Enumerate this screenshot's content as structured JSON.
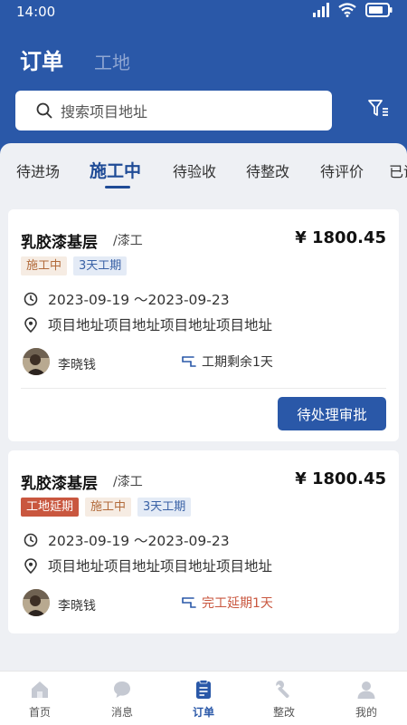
{
  "status_bar": {
    "time": "14:00",
    "icons": [
      "signal-icon",
      "wifi-icon",
      "battery-icon"
    ]
  },
  "header": {
    "tabs": [
      {
        "label": "订单",
        "active": true
      },
      {
        "label": "工地",
        "active": false
      }
    ]
  },
  "search": {
    "placeholder": "搜索项目地址"
  },
  "status_tabs": [
    "待进场",
    "施工中",
    "待验收",
    "待整改",
    "待评价",
    "已评"
  ],
  "active_status_tab": "施工中",
  "orders": [
    {
      "title": "乳胶漆基层",
      "type": "/漆工",
      "price": "¥ 1800.45",
      "tags": [
        {
          "label": "施工中",
          "style": "orange"
        },
        {
          "label": "3天工期",
          "style": "blue"
        }
      ],
      "date_range": "2023-09-19 ～2023-09-23",
      "address": "项目地址项目地址项目地址项目地址",
      "person": "李晓钱",
      "duration": "工期剩余1天",
      "action": "待处理审批"
    },
    {
      "title": "乳胶漆基层",
      "type": "/漆工",
      "price": "¥ 1800.45",
      "tags": [
        {
          "label": "工地延期",
          "style": "red"
        },
        {
          "label": "施工中",
          "style": "orange"
        },
        {
          "label": "3天工期",
          "style": "blue"
        }
      ],
      "date_range": "2023-09-19 ～2023-09-23",
      "address": "项目地址项目地址项目地址项目地址",
      "person": "李晓钱",
      "duration": "完工延期1天"
    }
  ],
  "bottom_nav": [
    {
      "label": "首页",
      "icon": "home-icon"
    },
    {
      "label": "消息",
      "icon": "message-icon"
    },
    {
      "label": "订单",
      "icon": "order-icon",
      "active": true
    },
    {
      "label": "整改",
      "icon": "wrench-icon"
    },
    {
      "label": "我的",
      "icon": "profile-icon"
    }
  ],
  "colors": {
    "primary": "#2a58a8",
    "warning": "#c9573f",
    "tag_orange_bg": "#f6ece3",
    "tag_blue_bg": "#e4ebf6"
  }
}
